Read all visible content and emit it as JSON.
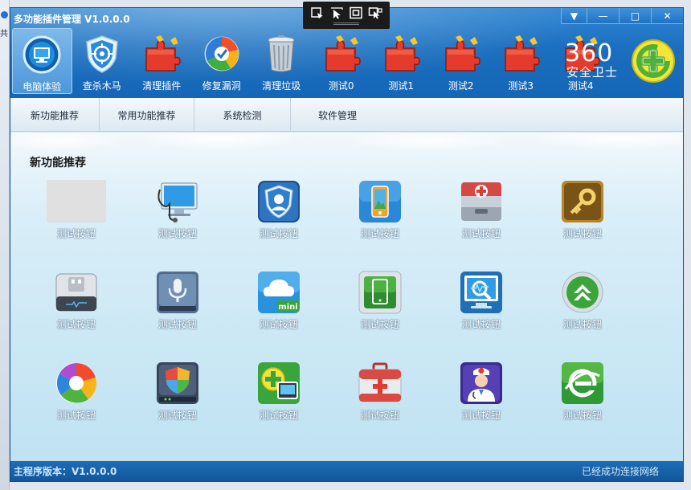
{
  "window": {
    "title": "多功能插件管理 V1.0.0.0",
    "controls": [
      "▼",
      "—",
      "□",
      "✕"
    ]
  },
  "toolbar": {
    "items": [
      {
        "label": "电脑体验",
        "icon": "monitor-shield-icon",
        "active": true
      },
      {
        "label": "查杀木马",
        "icon": "scan-shield-icon"
      },
      {
        "label": "清理插件",
        "icon": "puzzle-icon"
      },
      {
        "label": "修复漏洞",
        "icon": "repair-icon"
      },
      {
        "label": "清理垃圾",
        "icon": "trash-icon"
      },
      {
        "label": "测试0",
        "icon": "puzzle-icon"
      },
      {
        "label": "测试1",
        "icon": "puzzle-icon"
      },
      {
        "label": "测试2",
        "icon": "puzzle-icon"
      },
      {
        "label": "测试3",
        "icon": "puzzle-icon"
      },
      {
        "label": "测试4",
        "icon": "puzzle-icon"
      }
    ]
  },
  "brand": {
    "line1": "360",
    "line2": "安全卫士"
  },
  "tabs": [
    "新功能推荐",
    "常用功能推荐",
    "系统检测",
    "软件管理"
  ],
  "content": {
    "section_title": "新功能推荐",
    "buttons": [
      {
        "label": "测试按钮",
        "icon": "blank-icon"
      },
      {
        "label": "测试按钮",
        "icon": "stethoscope-monitor-icon"
      },
      {
        "label": "测试按钮",
        "icon": "user-shield-icon"
      },
      {
        "label": "测试按钮",
        "icon": "phone-screen-icon"
      },
      {
        "label": "测试按钮",
        "icon": "first-aid-box-icon"
      },
      {
        "label": "测试按钮",
        "icon": "key-icon"
      },
      {
        "label": "测试按钮",
        "icon": "usb-drive-icon"
      },
      {
        "label": "测试按钮",
        "icon": "microphone-icon"
      },
      {
        "label": "测试按钮",
        "icon": "cloud-mini-icon"
      },
      {
        "label": "测试按钮",
        "icon": "tablet-icon"
      },
      {
        "label": "测试按钮",
        "icon": "monitor-magnifier-icon"
      },
      {
        "label": "测试按钮",
        "icon": "upgrade-arrow-icon"
      },
      {
        "label": "测试按钮",
        "icon": "colorful-pinwheel-icon"
      },
      {
        "label": "测试按钮",
        "icon": "router-shield-icon"
      },
      {
        "label": "测试按钮",
        "icon": "screen-plus-icon"
      },
      {
        "label": "测试按钮",
        "icon": "medical-kit-icon"
      },
      {
        "label": "测试按钮",
        "icon": "doctor-icon"
      },
      {
        "label": "测试按钮",
        "icon": "green-e-browser-icon"
      }
    ]
  },
  "status": {
    "version": "主程序版本：V1.0.0.0",
    "network": "已经成功连接网络"
  }
}
